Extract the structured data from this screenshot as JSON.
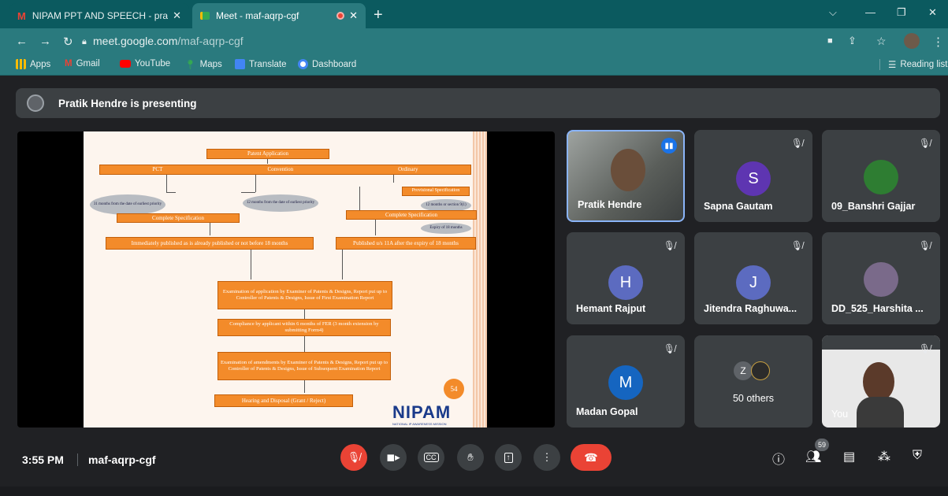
{
  "browser": {
    "tabs": [
      {
        "title": "NIPAM PPT AND SPEECH - pract",
        "icon": "gmail-icon"
      },
      {
        "title": "Meet - maf-aqrp-cgf",
        "icon": "meet-icon"
      }
    ],
    "url_host": "meet.google.com",
    "url_path": "/maf-aqrp-cgf",
    "bookmarks": [
      "Apps",
      "Gmail",
      "YouTube",
      "Maps",
      "Translate",
      "Dashboard"
    ],
    "reading_list": "Reading list"
  },
  "presenting_banner": "Pratik Hendre is presenting",
  "slide": {
    "boxes": {
      "patent_app": "Patent Application",
      "pct": "PCT",
      "convention": "Convention",
      "ordinary": "Ordinary",
      "provisional": "Provisional Specification",
      "complete_left": "Complete Specification",
      "complete_right": "Complete Specification",
      "published_left": "Immediately published as is already published or not before 18 months",
      "published_right": "Published u/s 11A after the expiry of 18 months",
      "exam": "Examination of application by Examiner of Patents & Designs, Report put up to Controller of Patents & Designs, Issue of First Examination Report",
      "compliance": "Compliance by applicant within 6 months of FER (3 month extension by submitting Form4)",
      "amend": "Examination of amendments by Examiner of Patents & Designs, Report put up to Controller of Patents & Designs, Issue of Subsequent Examination Report",
      "hearing": "Hearing and Disposal (Grant / Reject)"
    },
    "ovals": {
      "left": "31 months from the date of earliest priority",
      "middle": "12 months from the date of earliest priority",
      "twelve": "12 months or section 9(1)",
      "expiry": "Expiry of 18 months"
    },
    "page_number": "54",
    "logo": "NIPAM",
    "logo_sub": "NATIONAL IP AWARENESS MISSION"
  },
  "participants": [
    {
      "name": "Pratik Hendre",
      "initial": "",
      "color": "#8ab4f8"
    },
    {
      "name": "Sapna Gautam",
      "initial": "S",
      "color": "#5e35b1"
    },
    {
      "name": "09_Banshri Gajjar",
      "initial": "",
      "color": "#2e7d32"
    },
    {
      "name": "Hemant Rajput",
      "initial": "H",
      "color": "#5c6bc0"
    },
    {
      "name": "Jitendra Raghuwa...",
      "initial": "J",
      "color": "#5c6bc0"
    },
    {
      "name": "DD_525_Harshita ...",
      "initial": "",
      "color": "#7a6a8a"
    },
    {
      "name": "Madan Gopal",
      "initial": "M",
      "color": "#1565c0"
    },
    {
      "name": "50 others",
      "initial": "Z",
      "color": "#5f6368"
    },
    {
      "name": "You",
      "initial": "",
      "color": "#e8e8e8"
    }
  ],
  "meeting": {
    "time": "3:55 PM",
    "code": "maf-aqrp-cgf",
    "people_count": "59"
  }
}
